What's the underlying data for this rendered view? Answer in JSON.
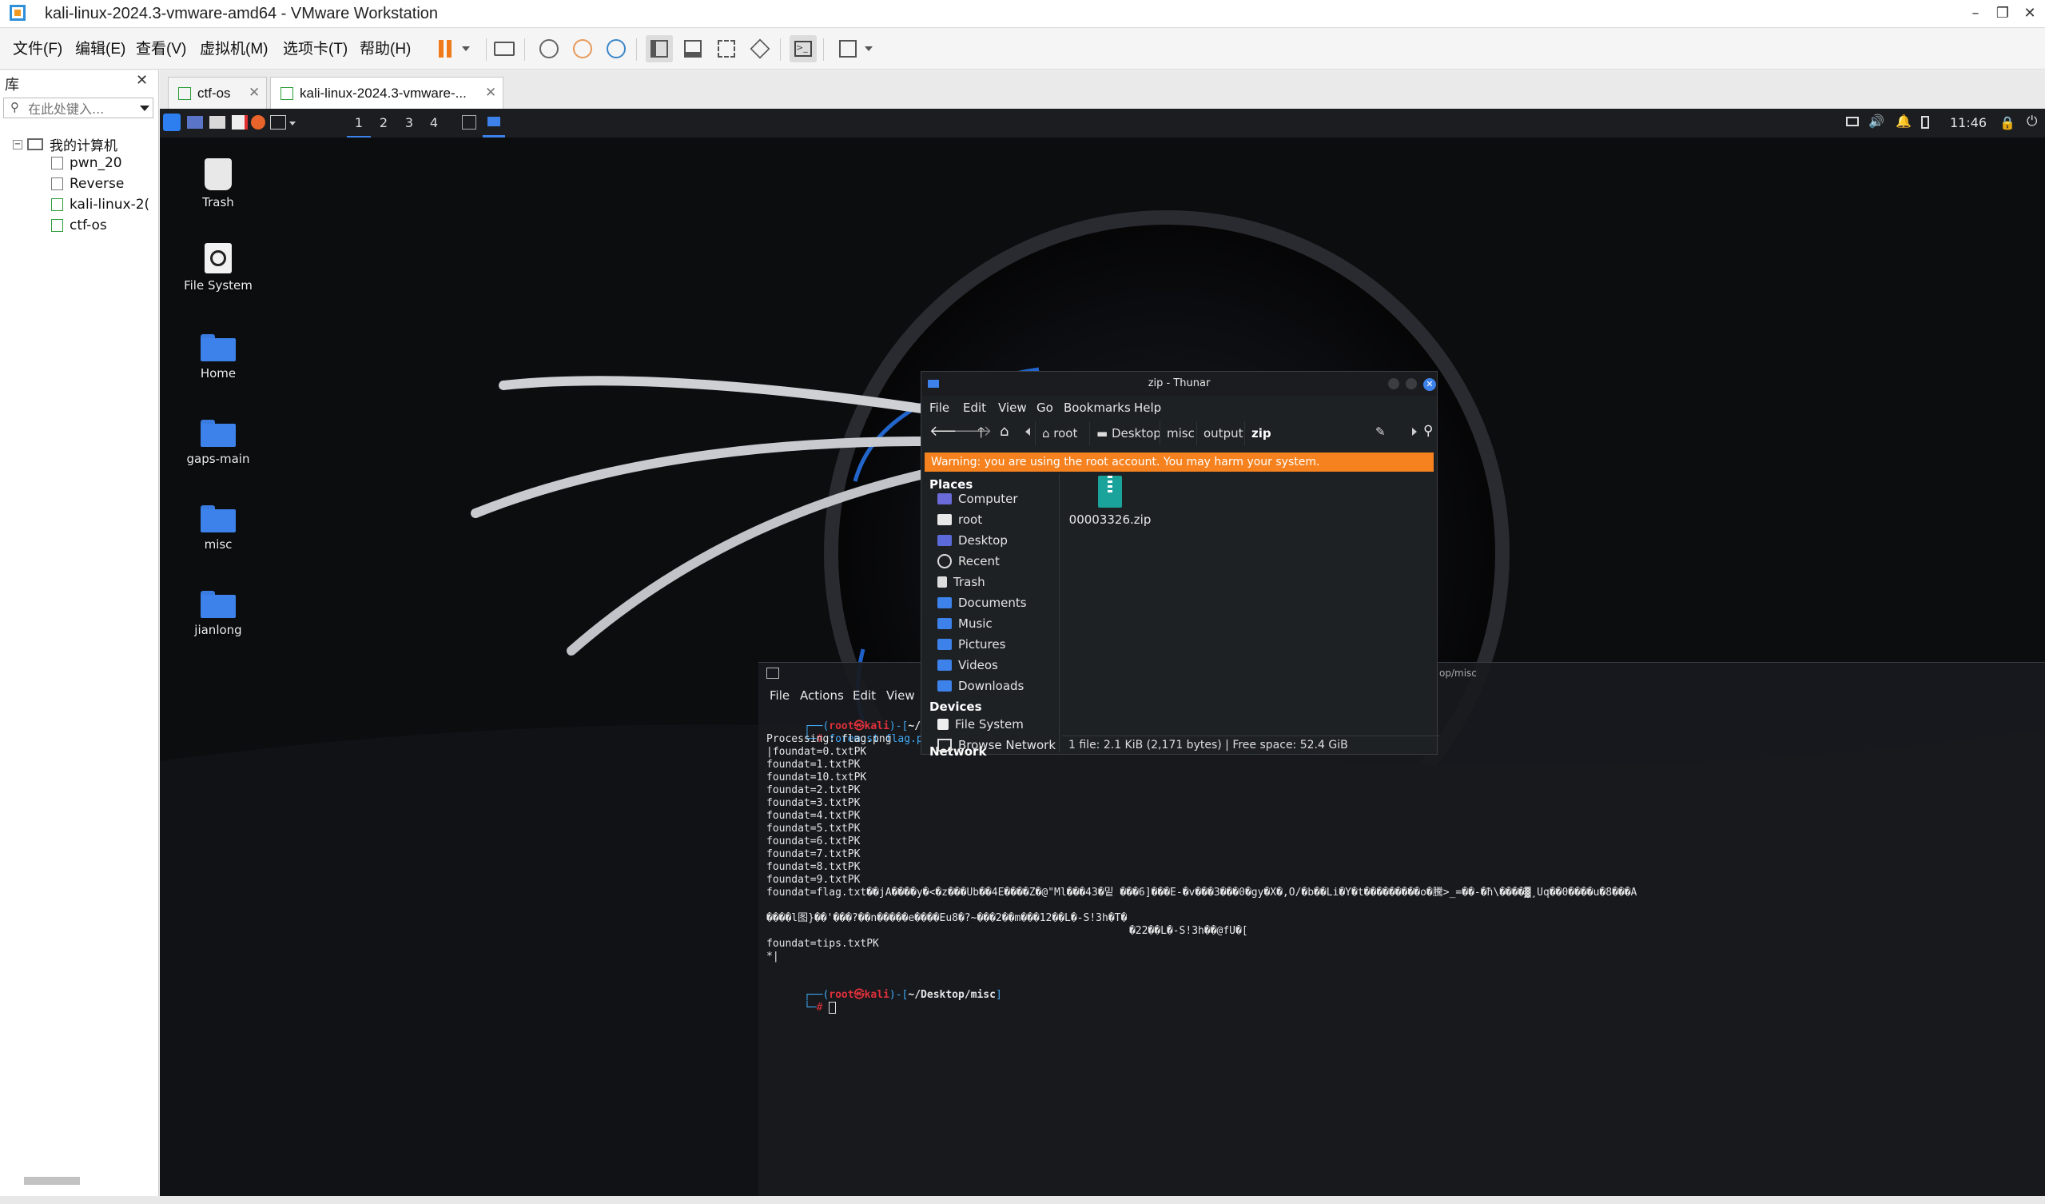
{
  "window": {
    "title": "kali-linux-2024.3-vmware-amd64 - VMware Workstation"
  },
  "menubar": {
    "items": [
      "文件(F)",
      "编辑(E)",
      "查看(V)",
      "虚拟机(M)",
      "选项卡(T)",
      "帮助(H)"
    ]
  },
  "library": {
    "title": "库",
    "search_placeholder": "在此处键入...",
    "root": "我的计算机",
    "vms": [
      "pwn_20",
      "Reverse",
      "kali-linux-2(",
      "ctf-os"
    ]
  },
  "tabs": [
    {
      "label": "ctf-os"
    },
    {
      "label": "kali-linux-2024.3-vmware-..."
    }
  ],
  "guest": {
    "panel": {
      "workspaces": [
        "1",
        "2",
        "3",
        "4"
      ],
      "clock": "11:46"
    },
    "desktop_icons": [
      "Trash",
      "File System",
      "Home",
      "gaps-main",
      "misc",
      "jianlong"
    ],
    "thunar": {
      "title": "zip - Thunar",
      "menu": [
        "File",
        "Edit",
        "View",
        "Go",
        "Bookmarks",
        "Help"
      ],
      "breadcrumbs": [
        "root",
        "Desktop",
        "misc",
        "output",
        "zip"
      ],
      "warning": "Warning: you are using the root account. You may harm your system.",
      "places_header": "Places",
      "places": [
        "Computer",
        "root",
        "Desktop",
        "Recent",
        "Trash",
        "Documents",
        "Music",
        "Pictures",
        "Videos",
        "Downloads"
      ],
      "devices_header": "Devices",
      "devices": [
        "File System"
      ],
      "network_header": "Network",
      "network": [
        "Browse Network"
      ],
      "file": "00003326.zip",
      "status": "1 file: 2.1 KiB (2,171 bytes)  |  Free space: 52.4 GiB"
    },
    "terminal": {
      "title_fragment": "op/misc",
      "menu": [
        "File",
        "Actions",
        "Edit",
        "View"
      ],
      "prompt_user": "root㉿kali",
      "prompt_path1": "~/Deskto",
      "command": "foremost flag.png",
      "output": [
        "Processing: flag.png",
        "|foundat=0.txtPK",
        "foundat=1.txtPK",
        "foundat=10.txtPK",
        "foundat=2.txtPK",
        "foundat=3.txtPK",
        "foundat=4.txtPK",
        "foundat=5.txtPK",
        "foundat=6.txtPK",
        "foundat=7.txtPK",
        "foundat=8.txtPK",
        "foundat=9.txtPK",
        "foundat=flag.txt��jA����y�<�z���Ub��4E����Z�@\"Ml���43�밑 ���6]���E-�v���3���0�gy�X�,O/�b��Li�Y�t���������o�騰>_=��-�ħ\\����▓¸Uq��0����u�8���A",
        "����l图}��'���?��n�����e����Eu8�?~���2��m���12��L�-S!3h�T�",
        "                                                          �22��L�-S!3h��@fÜ�[",
        "foundat=tips.txtPK",
        "*|"
      ],
      "prompt_path2": "~/Desktop/misc",
      "cursor": "#"
    }
  },
  "colors": {
    "accent_orange": "#f6821f",
    "kali_blue": "#3d82ea",
    "prompt_red": "#e0303a",
    "prompt_blue": "#3fa9f5"
  }
}
